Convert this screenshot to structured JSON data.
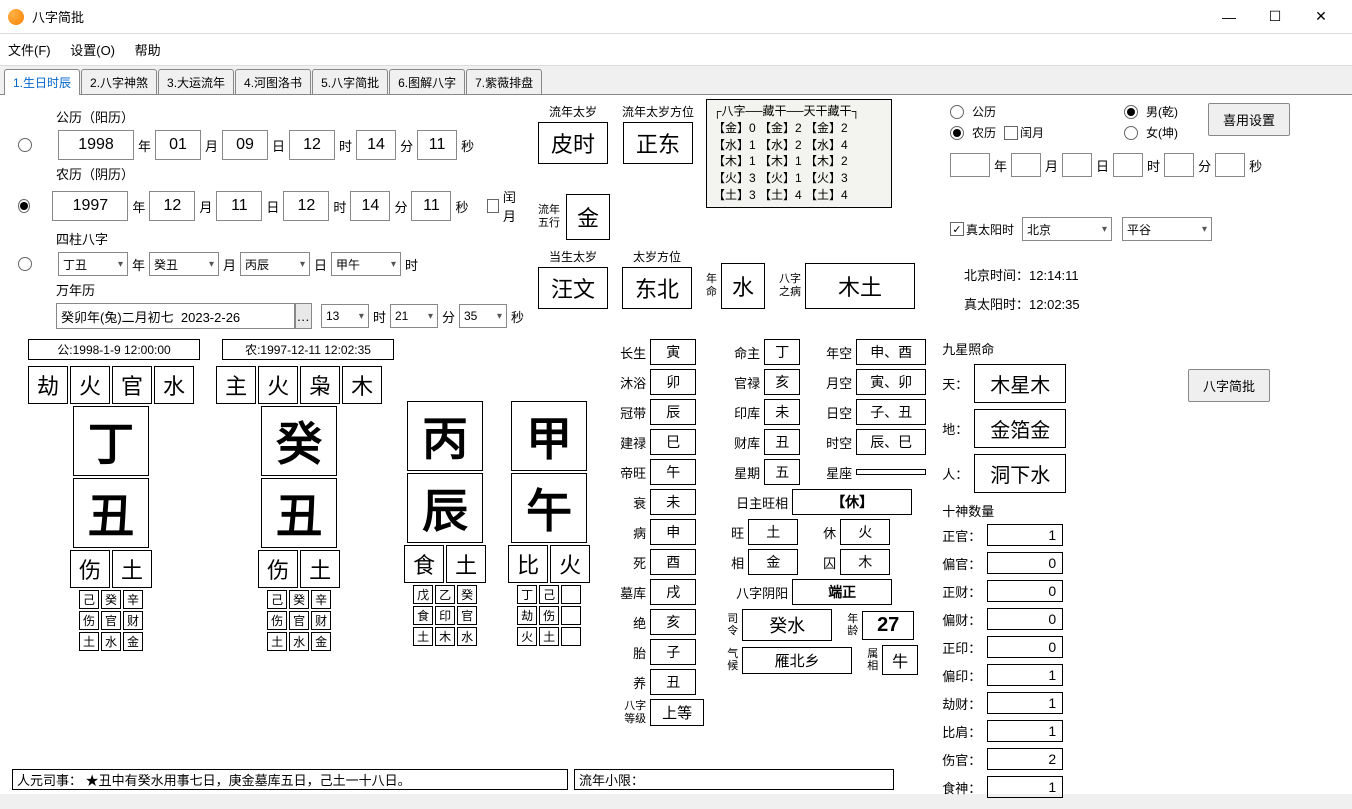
{
  "window": {
    "title": "八字简批"
  },
  "menu": {
    "file": "文件(F)",
    "settings": "设置(O)",
    "help": "帮助"
  },
  "tabs": [
    "1.生日时辰",
    "2.八字神煞",
    "3.大运流年",
    "4.河图洛书",
    "5.八字简批",
    "6.图解八字",
    "7.紫薇排盘"
  ],
  "solar": {
    "label": "公历（阳历）",
    "year": "1998",
    "month": "01",
    "day": "09",
    "hour": "12",
    "min": "14",
    "sec": "11",
    "y": "年",
    "m": "月",
    "d": "日",
    "h": "时",
    "mi": "分",
    "s": "秒"
  },
  "lunar": {
    "label": "农历（阴历）",
    "year": "1997",
    "month": "12",
    "day": "11",
    "hour": "12",
    "min": "14",
    "sec": "11",
    "leap": "闰月"
  },
  "pillars_sel": {
    "label": "四柱八字",
    "year": "丁丑",
    "month": "癸丑",
    "day": "丙辰",
    "hour": "甲午",
    "y": "年",
    "m": "月",
    "d": "日",
    "h": "时"
  },
  "perpetual": {
    "label": "万年历",
    "text": "癸卯年(兔)二月初七  2023-2-26",
    "hour": "13",
    "min": "21",
    "sec": "35",
    "h": "时",
    "mi": "分",
    "s": "秒"
  },
  "liunian": {
    "taisui_label": "流年太岁",
    "taisui": "皮时",
    "fangwei_label": "流年太岁方位",
    "fangwei": "正东",
    "wuxing_label": "流年\n五行",
    "wuxing": "金"
  },
  "dangsheng": {
    "taisui_label": "当生太岁",
    "taisui": "汪文",
    "fangwei_label": "太岁方位",
    "fangwei": "东北",
    "nianming_label": "年\n命",
    "nianming": "水",
    "bing_label": "八字\n之病",
    "bing": "木土"
  },
  "eightgrid": {
    "header": "┌八字──藏干──天干藏干┐",
    "rows": [
      "【金】0  【金】2  【金】2",
      "【水】1  【水】2  【水】4",
      "【木】1  【木】1  【木】2",
      "【火】3  【火】1  【火】3",
      "【土】3  【土】4  【土】4"
    ]
  },
  "disp": {
    "gong": "公:1998-1-9 12:00:00",
    "nong": "农:1997-12-11 12:02:35"
  },
  "cols": [
    {
      "ten1": "劫",
      "elem1": "火",
      "ten2": "官",
      "elem2": "水",
      "stem": "丁",
      "branch": "丑",
      "b1": "伤",
      "b2": "土",
      "hid": [
        "己",
        "癸",
        "辛"
      ],
      "hten": [
        "伤",
        "官",
        "财"
      ],
      "helem": [
        "土",
        "水",
        "金"
      ]
    },
    {
      "ten1": "主",
      "elem1": "火",
      "ten2": "枭",
      "elem2": "木",
      "stem": "癸",
      "branch": "丑",
      "b1": "伤",
      "b2": "土",
      "hid": [
        "己",
        "癸",
        "辛"
      ],
      "hten": [
        "伤",
        "官",
        "财"
      ],
      "helem": [
        "土",
        "水",
        "金"
      ]
    },
    {
      "ten1": "",
      "elem1": "",
      "ten2": "",
      "elem2": "",
      "stem": "丙",
      "branch": "辰",
      "b1": "食",
      "b2": "土",
      "hid": [
        "戊",
        "乙",
        "癸"
      ],
      "hten": [
        "食",
        "印",
        "官"
      ],
      "helem": [
        "土",
        "木",
        "水"
      ]
    },
    {
      "ten1": "",
      "elem1": "",
      "ten2": "",
      "elem2": "",
      "stem": "甲",
      "branch": "午",
      "b1": "比",
      "b2": "火",
      "hid": [
        "丁",
        "己",
        ""
      ],
      "hten": [
        "劫",
        "伤",
        ""
      ],
      "helem": [
        "火",
        "土",
        ""
      ]
    }
  ],
  "twelve": {
    "长生": "寅",
    "沐浴": "卯",
    "冠带": "辰",
    "建禄": "巳",
    "帝旺": "午",
    "衰": "未",
    "病": "申",
    "死": "酉",
    "墓库": "戌",
    "绝": "亥",
    "胎": "子",
    "养": "丑"
  },
  "bazi_dengji": {
    "label": "八字\n等级",
    "value": "上等"
  },
  "main": {
    "mingzhu": {
      "k": "命主",
      "v": "丁"
    },
    "niankon": {
      "k": "年空",
      "v": "申、酉"
    },
    "guanlu": {
      "k": "官禄",
      "v": "亥"
    },
    "yuekong": {
      "k": "月空",
      "v": "寅、卯"
    },
    "yinku": {
      "k": "印库",
      "v": "未"
    },
    "rikong": {
      "k": "日空",
      "v": "子、丑"
    },
    "caiku": {
      "k": "财库",
      "v": "丑"
    },
    "shikong": {
      "k": "时空",
      "v": "辰、巳"
    },
    "xingqi": {
      "k": "星期",
      "v": "五"
    },
    "xingzuo": {
      "k": "星座",
      "v": ""
    },
    "wangxiang": {
      "k": "日主旺相",
      "v": "【休】"
    },
    "wang": {
      "k": "旺",
      "v": "土"
    },
    "xiu": {
      "k": "休",
      "v": "火"
    },
    "xiang": {
      "k": "相",
      "v": "金"
    },
    "qiu": {
      "k": "囚",
      "v": "木"
    },
    "yinyang": {
      "k": "八字阴阳",
      "v": "端正"
    },
    "siling": {
      "k": "司\n令",
      "v": "癸水"
    },
    "nianling": {
      "k": "年\n龄",
      "v": "27"
    },
    "qihou": {
      "k": "气\n候",
      "v": "雁北乡"
    },
    "shuxiang": {
      "k": "属\n相",
      "v": "牛"
    }
  },
  "jiuxing": {
    "title": "九星照命",
    "tian": {
      "k": "天：",
      "v": "木星木"
    },
    "di": {
      "k": "地：",
      "v": "金箔金"
    },
    "ren": {
      "k": "人：",
      "v": "洞下水"
    }
  },
  "shishen": {
    "title": "十神数量",
    "items": [
      {
        "k": "正官：",
        "v": "1"
      },
      {
        "k": "偏官：",
        "v": "0"
      },
      {
        "k": "正财：",
        "v": "0"
      },
      {
        "k": "偏财：",
        "v": "0"
      },
      {
        "k": "正印：",
        "v": "0"
      },
      {
        "k": "偏印：",
        "v": "1"
      },
      {
        "k": "劫财：",
        "v": "1"
      },
      {
        "k": "比肩：",
        "v": "1"
      },
      {
        "k": "伤官：",
        "v": "2"
      },
      {
        "k": "食神：",
        "v": "1"
      }
    ]
  },
  "right": {
    "gongli": "公历",
    "nongli": "农历",
    "run": "闰月",
    "nan": "男(乾)",
    "nv": "女(坤)",
    "xiyong_btn": "喜用设置",
    "zhentaiyang": "真太阳时",
    "city": "北京",
    "district": "平谷",
    "bjtime_label": "北京时间：",
    "bjtime": "12:14:11",
    "truetime_label": "真太阳时：",
    "truetime": "12:02:35",
    "jianpi_btn": "八字简批",
    "y": "年",
    "m": "月",
    "d": "日",
    "h": "时",
    "mi": "分",
    "s": "秒"
  },
  "bottom": {
    "renyuan": "人元司事：    ★丑中有癸水用事七日，庚金墓库五日，己土一十八日。",
    "liunian": "流年小限："
  }
}
